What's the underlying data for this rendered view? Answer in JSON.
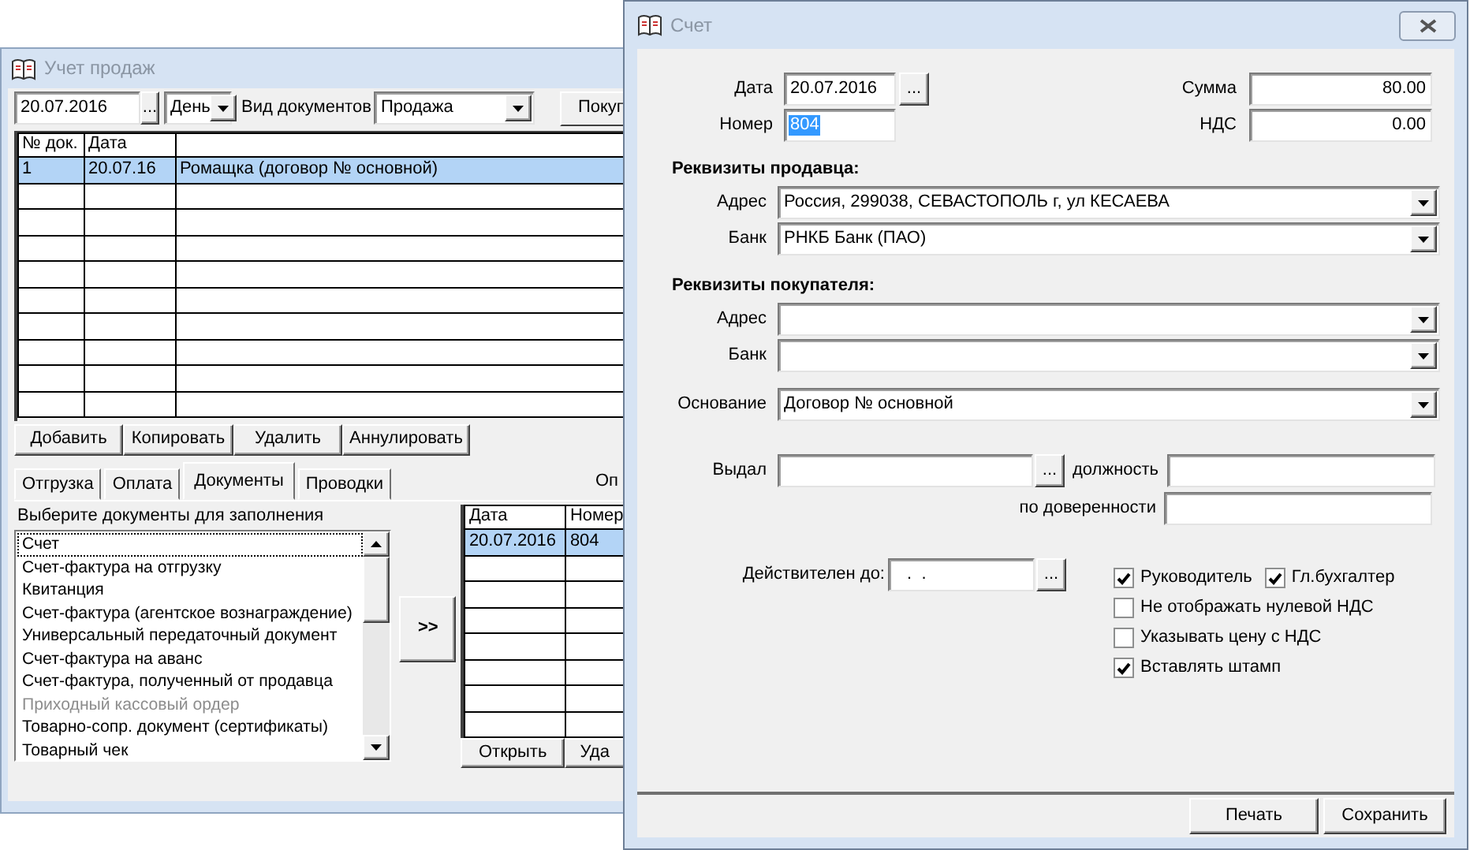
{
  "sales_window": {
    "title": "Учет продаж",
    "toolbar": {
      "date": "20.07.2016",
      "date_button": "...",
      "period": "День",
      "doc_type_label": "Вид документов",
      "doc_type": "Продажа",
      "button": "Покуп"
    },
    "documents_table": {
      "columns": [
        "№ док.",
        "Дата"
      ],
      "rows": [
        {
          "cells": [
            "1",
            "20.07.16",
            "Ромащка (договор № основной)"
          ],
          "selected": true
        }
      ]
    },
    "buttons": [
      "Добавить",
      "Копировать",
      "Удалить",
      "Аннулировать"
    ],
    "tabs": [
      {
        "label": "Отгрузка",
        "selected": false
      },
      {
        "label": "Оплата",
        "selected": false
      },
      {
        "label": "Документы",
        "selected": true
      },
      {
        "label": "Проводки",
        "selected": false
      }
    ],
    "side_label": "Оп",
    "documents_prompt": "Выберите документы для заполнения",
    "document_types": [
      {
        "label": "Счет",
        "focused": true,
        "disabled": false
      },
      {
        "label": "Счет-фактура на отгрузку",
        "focused": false,
        "disabled": false
      },
      {
        "label": "Квитанция",
        "focused": false,
        "disabled": false
      },
      {
        "label": "Счет-фактура (агентское вознаграждение)",
        "focused": false,
        "disabled": false
      },
      {
        "label": "Универсальный передаточный документ",
        "focused": false,
        "disabled": false
      },
      {
        "label": "Счет-фактура на аванс",
        "focused": false,
        "disabled": false
      },
      {
        "label": "Счет-фактура, полученный от продавца",
        "focused": false,
        "disabled": false
      },
      {
        "label": "Приходный кассовый ордер",
        "focused": false,
        "disabled": true
      },
      {
        "label": "Товарно-сопр. документ (сертификаты)",
        "focused": false,
        "disabled": false
      },
      {
        "label": "Товарный чек",
        "focused": false,
        "disabled": false
      }
    ],
    "move_button": ">>",
    "created_table": {
      "columns": [
        "Дата",
        "Номер"
      ],
      "rows": [
        {
          "cells": [
            "20.07.2016",
            "804"
          ],
          "selected": true
        }
      ]
    },
    "created_buttons": [
      "Открыть",
      "Уда"
    ]
  },
  "invoice_window": {
    "title": "Счет",
    "date": {
      "label": "Дата",
      "value": "20.07.2016",
      "button": "..."
    },
    "number": {
      "label": "Номер",
      "value": "804",
      "selected": true
    },
    "sum": {
      "label": "Сумма",
      "value": "80.00"
    },
    "vat": {
      "label": "НДС",
      "value": "0.00"
    },
    "seller": {
      "heading": "Реквизиты продавца:",
      "address_label": "Адрес",
      "address": "Россия, 299038, СЕВАСТОПОЛЬ г,  ул КЕСАЕВА",
      "bank_label": "Банк",
      "bank": "РНКБ Банк (ПАО)"
    },
    "buyer": {
      "heading": "Реквизиты покупателя:",
      "address_label": "Адрес",
      "bank_label": "Банк"
    },
    "basis": {
      "label": "Основание",
      "value": "Договор № основной"
    },
    "issued": {
      "label": "Выдал",
      "button": "...",
      "position_label": "должность",
      "proxy_label": "по доверенности"
    },
    "valid_until": {
      "label": "Действителен до:",
      "value": " .  .",
      "button": "..."
    },
    "checkbox_rows": [
      [
        {
          "label": "Руководитель",
          "checked": true
        },
        {
          "label": "Гл.бухгалтер",
          "checked": true
        }
      ],
      [
        {
          "label": "Не отображать нулевой НДС",
          "checked": false
        }
      ],
      [
        {
          "label": "Указывать цену с НДС",
          "checked": false
        }
      ],
      [
        {
          "label": "Вставлять штамп",
          "checked": true
        }
      ]
    ],
    "buttons": [
      "Печать",
      "Сохранить"
    ]
  }
}
